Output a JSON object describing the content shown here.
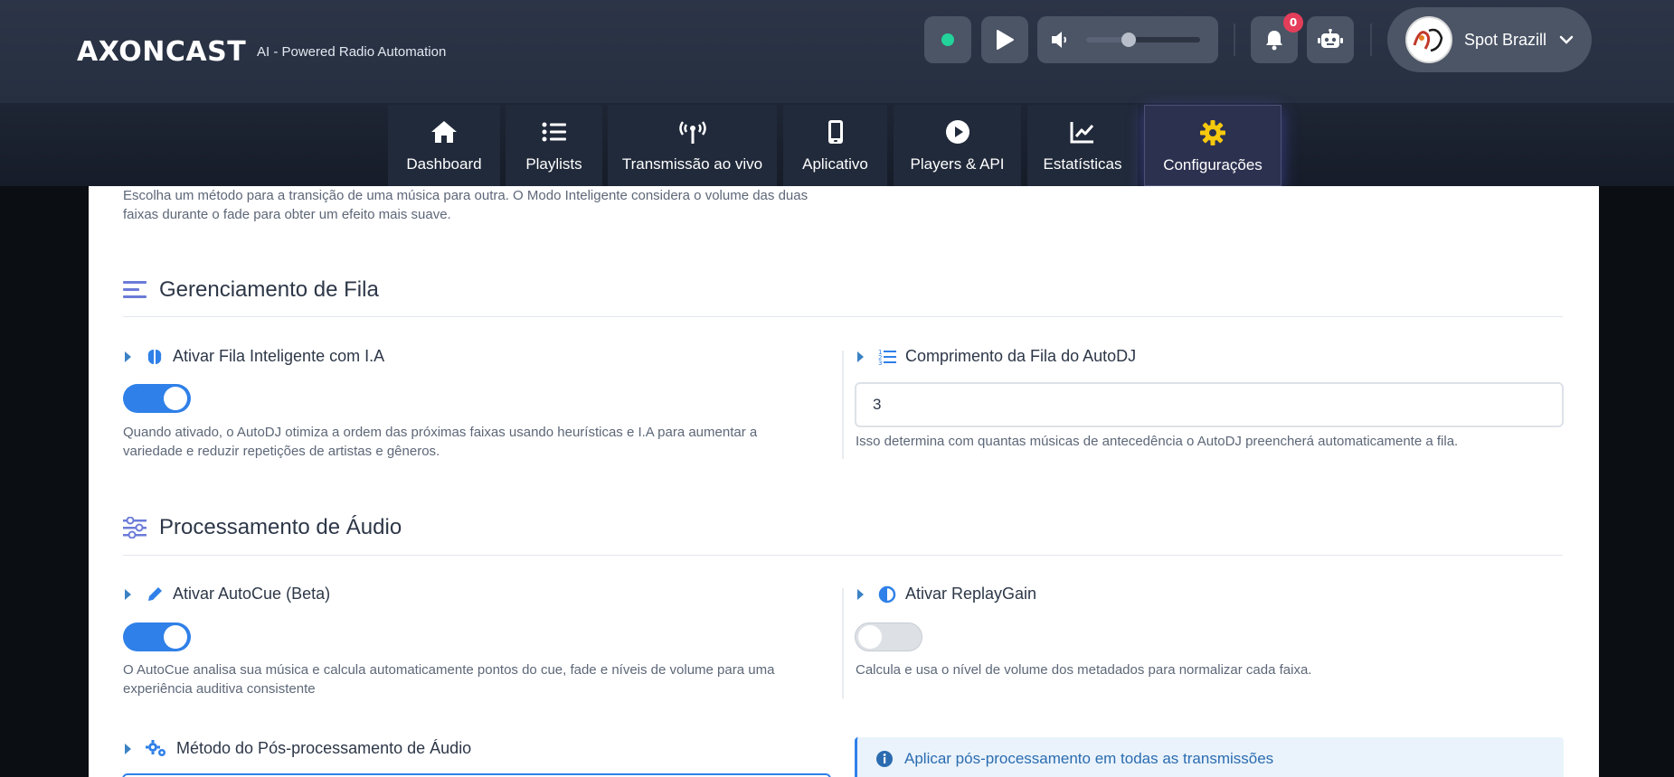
{
  "brand": {
    "logo": "AXONCAST",
    "tagline": "AI - Powered Radio Automation"
  },
  "header": {
    "status_color": "#22d39a",
    "volume_level": 0.37,
    "notifications_count": "0",
    "user_name": "Spot Brazill",
    "icons": [
      "status-dot",
      "play-icon",
      "volume-icon",
      "bell-icon",
      "robot-icon",
      "chevron-down-icon"
    ]
  },
  "nav": {
    "tabs": [
      {
        "label": "Dashboard",
        "icon": "home-icon"
      },
      {
        "label": "Playlists",
        "icon": "list-icon"
      },
      {
        "label": "Transmissão ao vivo",
        "icon": "broadcast-tower-icon"
      },
      {
        "label": "Aplicativo",
        "icon": "mobile-icon"
      },
      {
        "label": "Players & API",
        "icon": "play-circle-icon"
      },
      {
        "label": "Estatísticas",
        "icon": "chart-line-icon"
      },
      {
        "label": "Configurações",
        "icon": "gear-icon",
        "active": true
      }
    ],
    "active_color": "#f6c90e"
  },
  "crossfade": {
    "help": "Escolha um método para a transição de uma música para outra. O Modo Inteligente considera o volume das duas faixas durante o fade para obter um efeito mais suave."
  },
  "queue_section": {
    "title": "Gerenciamento de Fila",
    "smart_queue": {
      "label": "Ativar Fila Inteligente com I.A",
      "enabled": true,
      "help": "Quando ativado, o AutoDJ otimiza a ordem das próximas faixas usando heurísticas e I.A para aumentar a variedade e reduzir repetições de artistas e gêneros."
    },
    "queue_length": {
      "label": "Comprimento da Fila do AutoDJ",
      "value": "3",
      "help": "Isso determina com quantas músicas de antecedência o AutoDJ preencherá automaticamente a fila."
    }
  },
  "audio_section": {
    "title": "Processamento de Áudio",
    "autocue": {
      "label": "Ativar AutoCue (Beta)",
      "enabled": true,
      "help": "O AutoCue analisa sua música e calcula automaticamente pontos do cue, fade e níveis de volume para uma experiência auditiva consistente"
    },
    "replaygain": {
      "label": "Ativar ReplayGain",
      "enabled": false,
      "help": "Calcula e usa o nível de volume dos metadados para normalizar cada faixa."
    },
    "post_processing": {
      "label": "Método do Pós-processamento de Áudio"
    },
    "apply_all": {
      "label": "Aplicar pós-processamento em todas as transmissões"
    }
  },
  "colors": {
    "accent_blue": "#2f80e8",
    "section_icon": "#6b7bd8",
    "toggle_off": "#dde1e6"
  }
}
